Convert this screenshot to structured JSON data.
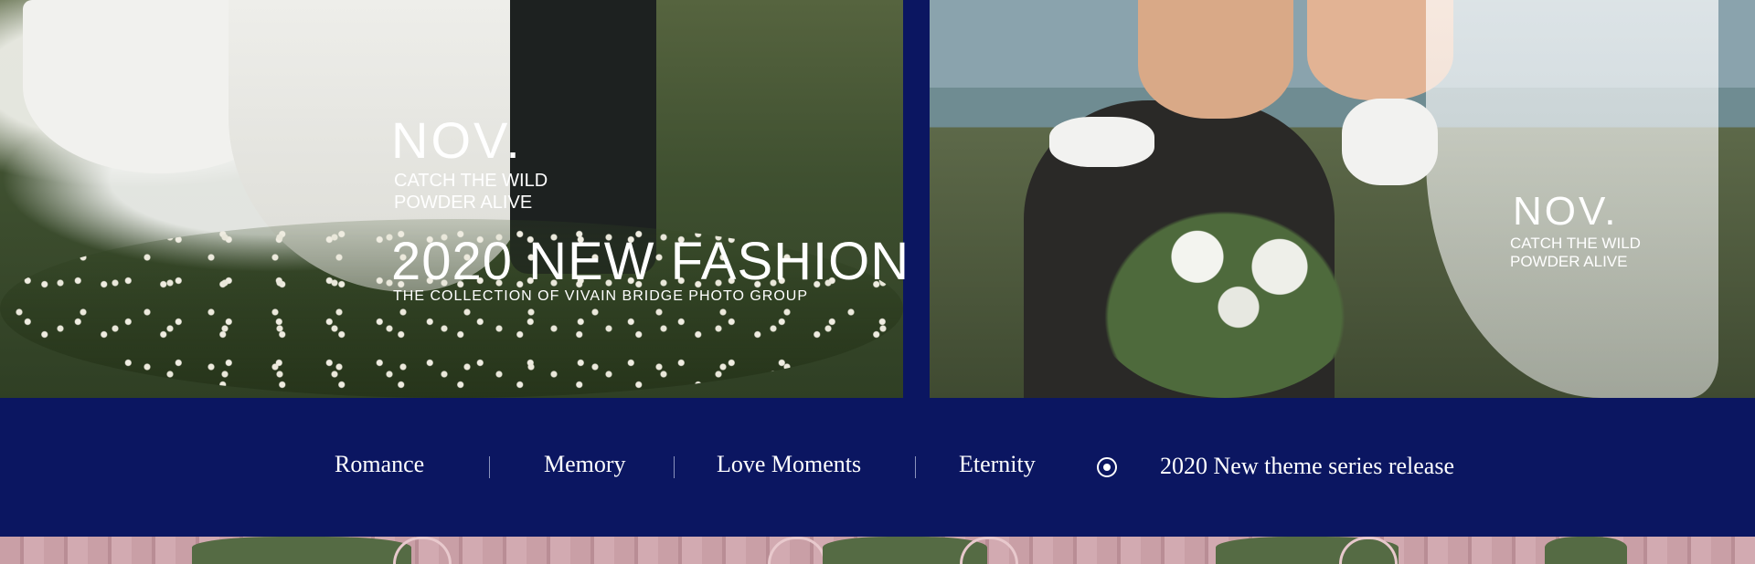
{
  "photos": {
    "left": {
      "overlay": {
        "nov": "NOV.",
        "catch_line1": "CATCH THE WILD",
        "catch_line2": "POWDER ALIVE",
        "fashion": "2020 NEW FASHION",
        "collection": "THE COLLECTION OF VIVAIN BRIDGE PHOTO GROUP"
      }
    },
    "right": {
      "overlay": {
        "nov": "NOV.",
        "catch_line1": "CATCH THE WILD",
        "catch_line2": "POWDER ALIVE"
      }
    }
  },
  "nav": {
    "items": [
      "Romance",
      "Memory",
      "Love Moments",
      "Eternity"
    ],
    "release_text": "2020 New theme series release"
  },
  "colors": {
    "band": "#0b1661",
    "text": "#ffffff"
  }
}
